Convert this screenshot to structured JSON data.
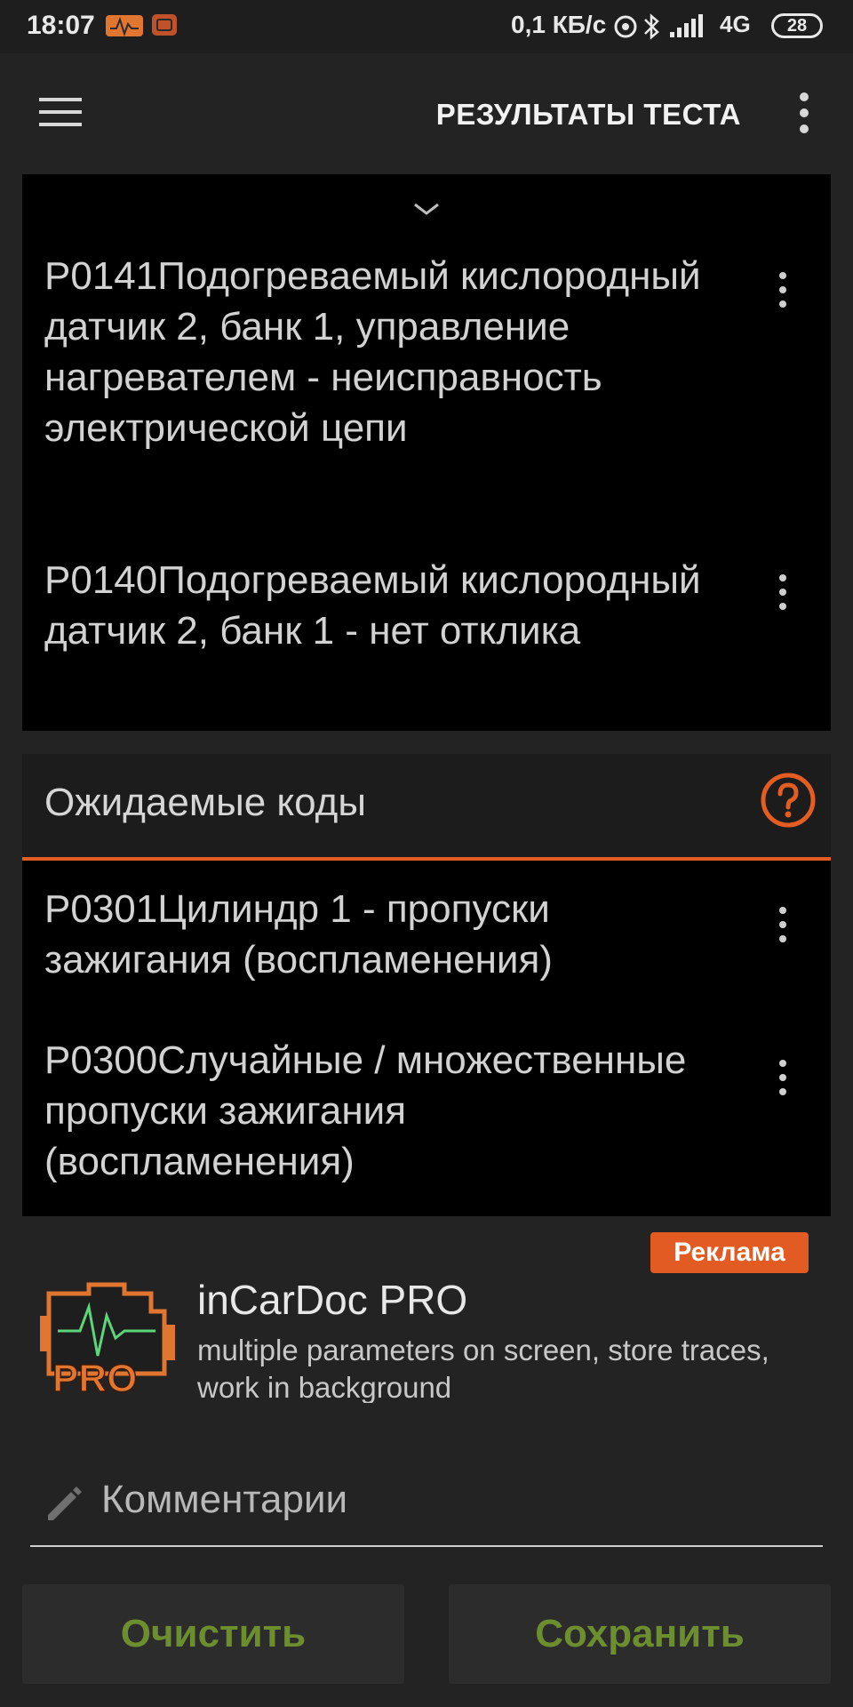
{
  "status_bar": {
    "time": "18:07",
    "speed": "0,1 КБ/с",
    "network": "4G",
    "battery": "28"
  },
  "app_bar": {
    "title": "РЕЗУЛЬТАТЫ ТЕСТА",
    "menu_icon": "hamburger-icon",
    "overflow_icon": "more-vert-icon"
  },
  "confirmed_codes": [
    {
      "code": "P0141",
      "description": "Подогреваемый кислородный датчик 2, банк 1, управление нагревателем - неисправность электрической цепи"
    },
    {
      "code": "P0140",
      "description": "Подогреваемый кислородный датчик 2, банк 1 - нет отклика"
    }
  ],
  "pending": {
    "title": "Ожидаемые коды",
    "help_icon": "help-circle-icon",
    "codes": [
      {
        "code": "P0301",
        "description": "Цилиндр 1 - пропуски зажигания (воспламенения)"
      },
      {
        "code": "P0300",
        "description": "Случайные / множественные пропуски зажигания (воспламенения)"
      }
    ]
  },
  "ad": {
    "badge": "Реклама",
    "title": "inCarDoc PRO",
    "description": "multiple parameters on screen, store traces, work in background",
    "logo_text": "PRO",
    "accent_color": "#e25b22"
  },
  "comment": {
    "placeholder": "Комментарии",
    "value": ""
  },
  "buttons": {
    "clear": "Очистить",
    "save": "Сохранить"
  },
  "colors": {
    "accent": "#e35c22",
    "button_text": "#6d8e2e",
    "background": "#232323",
    "card": "#000000"
  }
}
